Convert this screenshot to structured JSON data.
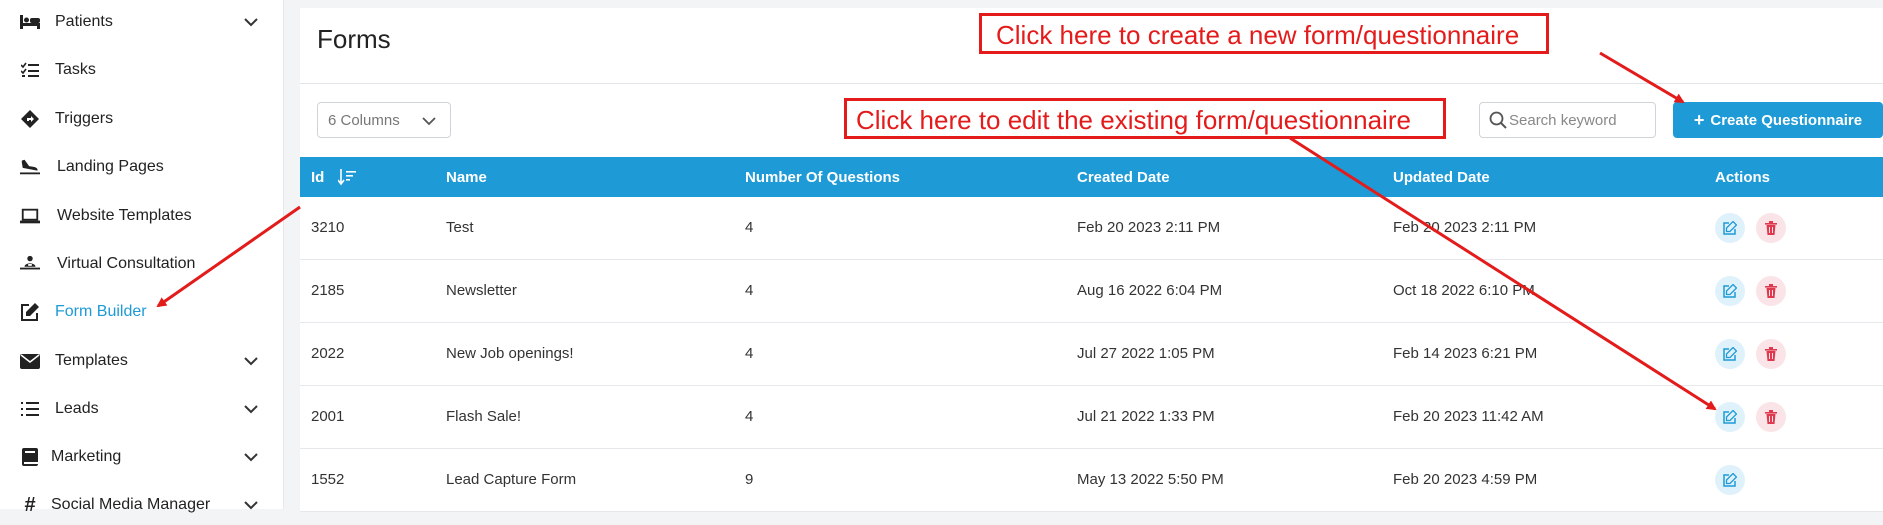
{
  "sidebar": {
    "items": [
      {
        "label": "Patients",
        "icon": "bed-icon",
        "has_chevron": true
      },
      {
        "label": "Tasks",
        "icon": "checklist-icon",
        "has_chevron": false
      },
      {
        "label": "Triggers",
        "icon": "diamond-arrow-icon",
        "has_chevron": false
      },
      {
        "label": "Landing Pages",
        "icon": "plane-landing-icon",
        "has_chevron": false
      },
      {
        "label": "Website Templates",
        "icon": "laptop-icon",
        "has_chevron": false
      },
      {
        "label": "Virtual Consultation",
        "icon": "doctor-icon",
        "has_chevron": false
      },
      {
        "label": "Form Builder",
        "icon": "edit-form-icon",
        "has_chevron": false,
        "active": true
      },
      {
        "label": "Templates",
        "icon": "envelope-icon",
        "has_chevron": true
      },
      {
        "label": "Leads",
        "icon": "list-icon",
        "has_chevron": true
      },
      {
        "label": "Marketing",
        "icon": "book-icon",
        "has_chevron": true
      },
      {
        "label": "Social Media Manager",
        "icon": "hashtag-icon",
        "has_chevron": true
      }
    ]
  },
  "page": {
    "title": "Forms"
  },
  "toolbar": {
    "columns_label": "6 Columns",
    "search_placeholder": "Search keyword",
    "search_value": "",
    "create_label": "Create Questionnaire"
  },
  "table": {
    "columns": [
      "Id",
      "Name",
      "Number Of Questions",
      "Created Date",
      "Updated Date",
      "Actions"
    ],
    "rows": [
      {
        "id": "3210",
        "name": "Test",
        "questions": "4",
        "created": "Feb 20 2023 2:11 PM",
        "updated": "Feb 20 2023 2:11 PM",
        "can_delete": true
      },
      {
        "id": "2185",
        "name": "Newsletter",
        "questions": "4",
        "created": "Aug 16 2022 6:04 PM",
        "updated": "Oct 18 2022 6:10 PM",
        "can_delete": true
      },
      {
        "id": "2022",
        "name": "New Job openings!",
        "questions": "4",
        "created": "Jul 27 2022 1:05 PM",
        "updated": "Feb 14 2023 6:21 PM",
        "can_delete": true
      },
      {
        "id": "2001",
        "name": "Flash Sale!",
        "questions": "4",
        "created": "Jul 21 2022 1:33 PM",
        "updated": "Feb 20 2023 11:42 AM",
        "can_delete": true
      },
      {
        "id": "1552",
        "name": "Lead Capture Form",
        "questions": "9",
        "created": "May 13 2022 5:50 PM",
        "updated": "Feb 20 2023 4:59 PM",
        "can_delete": false
      }
    ]
  },
  "annotations": {
    "create_note": "Click here to create a new form/questionnaire",
    "edit_note": "Click here to edit the existing form/questionnaire",
    "color": "#e31b1b"
  },
  "colors": {
    "accent": "#1e9ad6",
    "delete": "#e0394f"
  }
}
